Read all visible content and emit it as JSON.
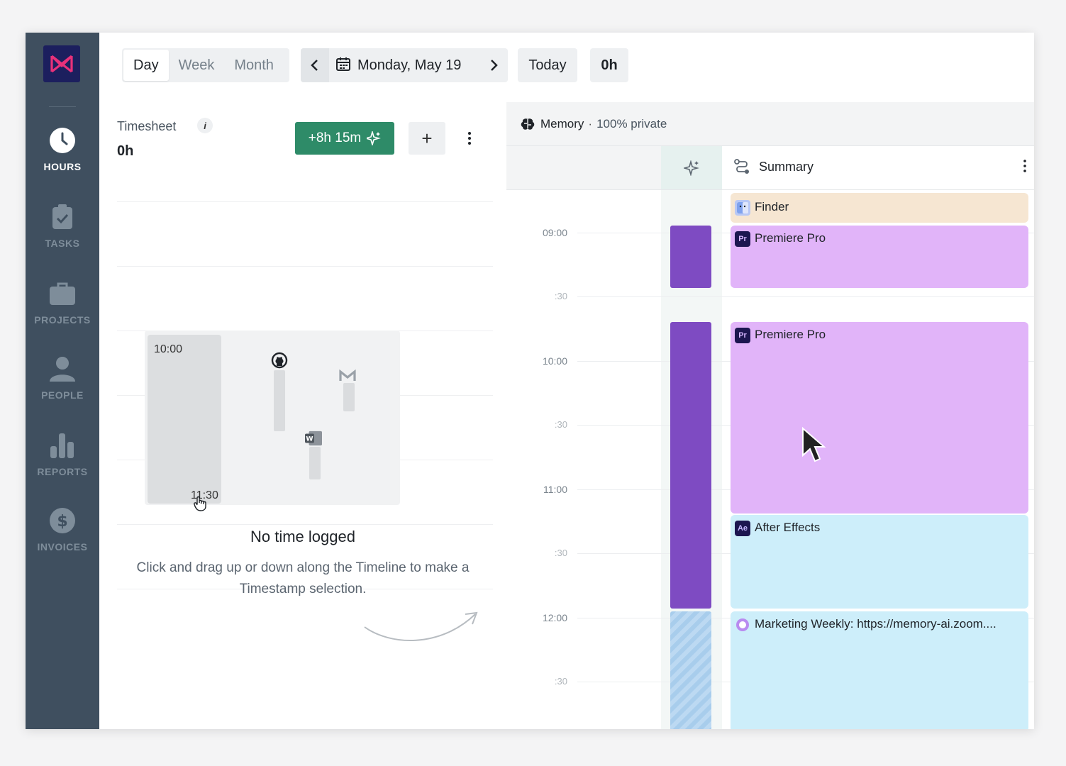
{
  "sidebar": {
    "items": [
      {
        "label": "HOURS",
        "icon": "clock-icon",
        "active": true
      },
      {
        "label": "TASKS",
        "icon": "clipboard-check-icon"
      },
      {
        "label": "PROJECTS",
        "icon": "briefcase-icon"
      },
      {
        "label": "PEOPLE",
        "icon": "person-icon"
      },
      {
        "label": "REPORTS",
        "icon": "bar-chart-icon"
      },
      {
        "label": "INVOICES",
        "icon": "dollar-icon"
      }
    ]
  },
  "toolbar": {
    "view_tabs": [
      "Day",
      "Week",
      "Month"
    ],
    "active_view": "Day",
    "date": "Monday, May 19",
    "today_label": "Today",
    "total": "0h"
  },
  "timesheet": {
    "title": "Timesheet",
    "info": "i",
    "total": "0h",
    "suggest_label": "+8h 15m",
    "add_label": "+",
    "illustration": {
      "start": "10:00",
      "end": "11:30"
    },
    "empty_title": "No time logged",
    "empty_desc": "Click and drag up or down along the Timeline to make a Timestamp selection."
  },
  "memory": {
    "title": "Memory",
    "privacy": "100% private",
    "summary_label": "Summary",
    "time_labels": [
      "09:00",
      ":30",
      "10:00",
      ":30",
      "11:00",
      ":30",
      "12:00",
      ":30"
    ],
    "events": [
      {
        "title": "Finder",
        "icon_text": "",
        "color": "#f6e6d2"
      },
      {
        "title": "Premiere Pro",
        "icon_text": "Pr",
        "color": "#e1b4f9"
      },
      {
        "title": "Premiere Pro",
        "icon_text": "Pr",
        "color": "#e1b4f9"
      },
      {
        "title": "After Effects",
        "icon_text": "Ae",
        "color": "#cdeefa"
      },
      {
        "title": "Marketing Weekly: https://memory-ai.zoom....",
        "icon_text": "",
        "color": "#cdeefa"
      }
    ]
  },
  "colors": {
    "sidebar": "#3f4f5f",
    "accent_green": "#2e8b68",
    "activity_purple": "#7e4bc2",
    "logo_bg": "#1c1f5e",
    "logo_fg": "#e8317a"
  }
}
